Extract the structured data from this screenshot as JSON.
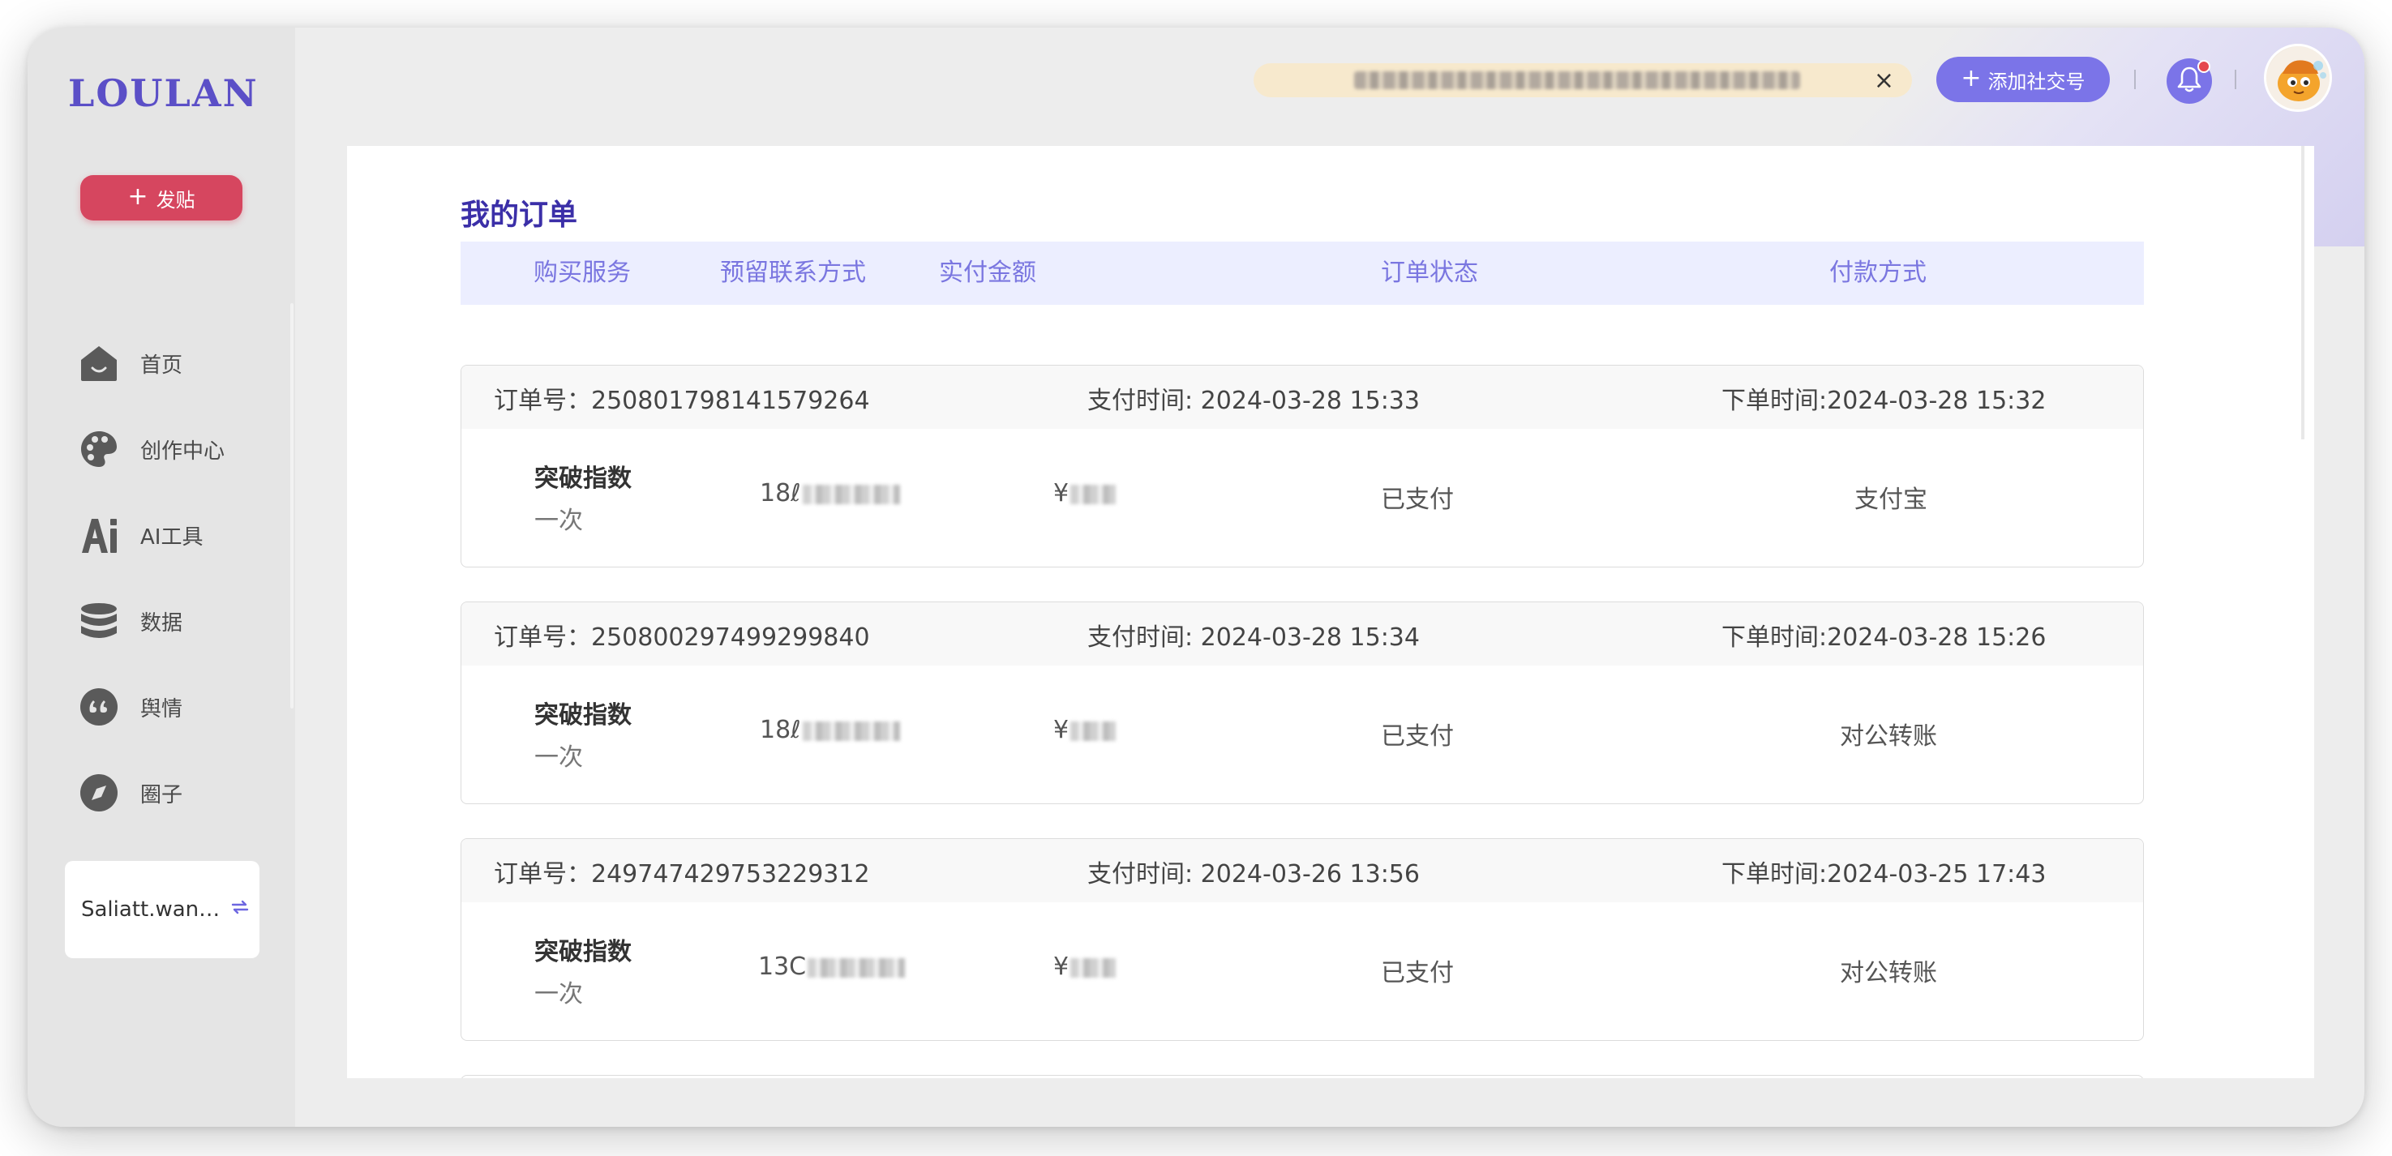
{
  "sidebar": {
    "logo": "LOULAN",
    "post_button": "发贴",
    "nav": [
      {
        "label": "首页",
        "icon": "home-icon"
      },
      {
        "label": "创作中心",
        "icon": "palette-icon"
      },
      {
        "label": "AI工具",
        "icon": "ai-icon"
      },
      {
        "label": "数据",
        "icon": "database-icon"
      },
      {
        "label": "舆情",
        "icon": "quote-icon"
      },
      {
        "label": "圈子",
        "icon": "compass-icon"
      }
    ],
    "user": {
      "name": "Saliatt.wan…",
      "icon": "switch-icon"
    }
  },
  "topbar": {
    "notice_close": "×",
    "add_account_label": "添加社交号",
    "has_unread": true
  },
  "page": {
    "title": "我的订单",
    "columns": [
      "购买服务",
      "预留联系方式",
      "实付金额",
      "订单状态",
      "付款方式"
    ]
  },
  "orders": [
    {
      "order_no": "订单号：250801798141579264",
      "pay_time": "支付时间: 2024-03-28 15:33",
      "order_time": "下单时间:2024-03-28 15:32",
      "service": "突破指数",
      "service_sub": "一次",
      "contact": "18ℓ",
      "amount": "¥",
      "status": "已支付",
      "pay_method": "支付宝"
    },
    {
      "order_no": "订单号：250800297499299840",
      "pay_time": "支付时间: 2024-03-28 15:34",
      "order_time": "下单时间:2024-03-28 15:26",
      "service": "突破指数",
      "service_sub": "一次",
      "contact": "18ℓ",
      "amount": "¥",
      "status": "已支付",
      "pay_method": "对公转账"
    },
    {
      "order_no": "订单号：249747429753229312",
      "pay_time": "支付时间: 2024-03-26 13:56",
      "order_time": "下单时间:2024-03-25 17:43",
      "service": "突破指数",
      "service_sub": "一次",
      "contact": "13C",
      "amount": "¥",
      "status": "已支付",
      "pay_method": "对公转账"
    }
  ],
  "colors": {
    "accent": "#7b74e8",
    "logo": "#5b4fc7",
    "post_button": "#d6465f",
    "title": "#3b2fa8",
    "header_bg": "#eceeff"
  }
}
